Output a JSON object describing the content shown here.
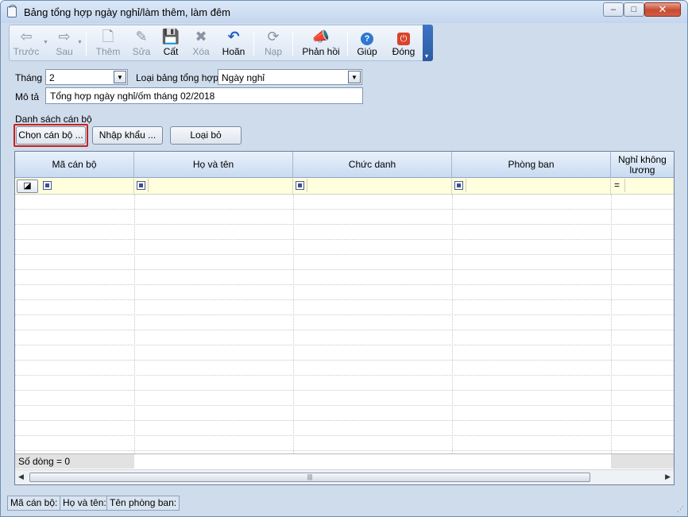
{
  "window": {
    "title": "Bảng tổng hợp ngày nghỉ/làm thêm, làm đêm",
    "controls": {
      "minimize": "–",
      "maximize": "□",
      "close": "✕"
    }
  },
  "toolbar": {
    "items": [
      {
        "label": "Trước",
        "icon": "arrow-left-icon",
        "glyph": "⇦",
        "enabled": false
      },
      {
        "label": "Sau",
        "icon": "arrow-right-icon",
        "glyph": "⇨",
        "enabled": false
      },
      {
        "label": "Thêm",
        "icon": "add-document-icon",
        "glyph": "🗋",
        "enabled": false
      },
      {
        "label": "Sửa",
        "icon": "edit-document-icon",
        "glyph": "✎",
        "enabled": false
      },
      {
        "label": "Cất",
        "icon": "save-icon",
        "glyph": "💾",
        "enabled": true
      },
      {
        "label": "Xóa",
        "icon": "delete-document-icon",
        "glyph": "✖",
        "enabled": false
      },
      {
        "label": "Hoãn",
        "icon": "undo-icon",
        "glyph": "↶",
        "enabled": true
      },
      {
        "label": "Nạp",
        "icon": "reload-icon",
        "glyph": "⟳",
        "enabled": false
      },
      {
        "label": "Phản hồi",
        "icon": "feedback-megaphone-icon",
        "glyph": "📣",
        "enabled": true
      },
      {
        "label": "Giúp",
        "icon": "help-icon",
        "glyph": "?",
        "enabled": true
      },
      {
        "label": "Đóng",
        "icon": "power-close-icon",
        "glyph": "⏻",
        "enabled": true
      }
    ],
    "overflow_glyph": "▾"
  },
  "form": {
    "month_label": "Tháng",
    "month_value": "2",
    "summary_type_label": "Loại bảng tổng hợp",
    "summary_type_value": "Ngày nghỉ",
    "description_label": "Mô tả",
    "description_value": "Tổng hợp ngày nghỉ/ốm tháng 02/2018",
    "dropdown_arrow": "▼",
    "staff_list_label": "Danh sách cán bộ"
  },
  "actions": {
    "select_staff": "Chọn cán bộ ...",
    "import": "Nhập khẩu ...",
    "remove": "Loại bỏ"
  },
  "grid": {
    "columns": [
      "Mã cán bộ",
      "Họ và tên",
      "Chức danh",
      "Phòng ban",
      "Nghỉ không lương"
    ],
    "filter_button_glyph": "◪",
    "filter_eq": "=",
    "rows": [],
    "footer_count": "Số dòng = 0",
    "scroll_left": "◀",
    "scroll_right": "▶",
    "scroll_grip": "|||"
  },
  "statusbar": {
    "staff_code": "Mã cán bộ:",
    "full_name": "Họ và tên:",
    "department": "Tên phòng ban:"
  },
  "colors": {
    "window_bg": "#cfdcec",
    "focus_border": "#c8211c",
    "filter_row_bg": "#fffedd",
    "close_button": "#c74a2e"
  }
}
